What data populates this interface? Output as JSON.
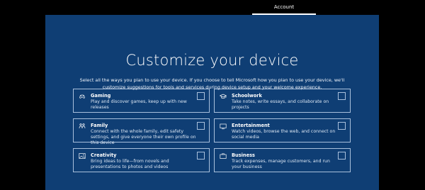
{
  "nav": {
    "tab_label": "Account"
  },
  "page": {
    "title": "Customize your device",
    "subtitle": "Select all the ways you plan to use your device. If you choose to tell Microsoft how you plan to use your device, we'll customize suggestions for tools and services during device setup and your welcome experience."
  },
  "options": [
    {
      "title": "Gaming",
      "desc": "Play and discover games, keep up with new releases",
      "icon": "gamepad-icon",
      "checked": false
    },
    {
      "title": "Schoolwork",
      "desc": "Take notes, write essays, and collaborate on projects",
      "icon": "graduation-cap-icon",
      "checked": false
    },
    {
      "title": "Family",
      "desc": "Connect with the whole family, edit safety settings, and give everyone their own profile on this device",
      "icon": "family-icon",
      "checked": false
    },
    {
      "title": "Entertainment",
      "desc": "Watch videos, browse the web, and connect on social media",
      "icon": "tv-icon",
      "checked": false
    },
    {
      "title": "Creativity",
      "desc": "Bring ideas to life—from novels and presentations to photos and videos",
      "icon": "image-icon",
      "checked": false
    },
    {
      "title": "Business",
      "desc": "Track expenses, manage customers, and run your business",
      "icon": "briefcase-icon",
      "checked": false
    }
  ],
  "colors": {
    "panel": "#0f3e74",
    "border": "#a9c0dc",
    "background": "#000000"
  }
}
